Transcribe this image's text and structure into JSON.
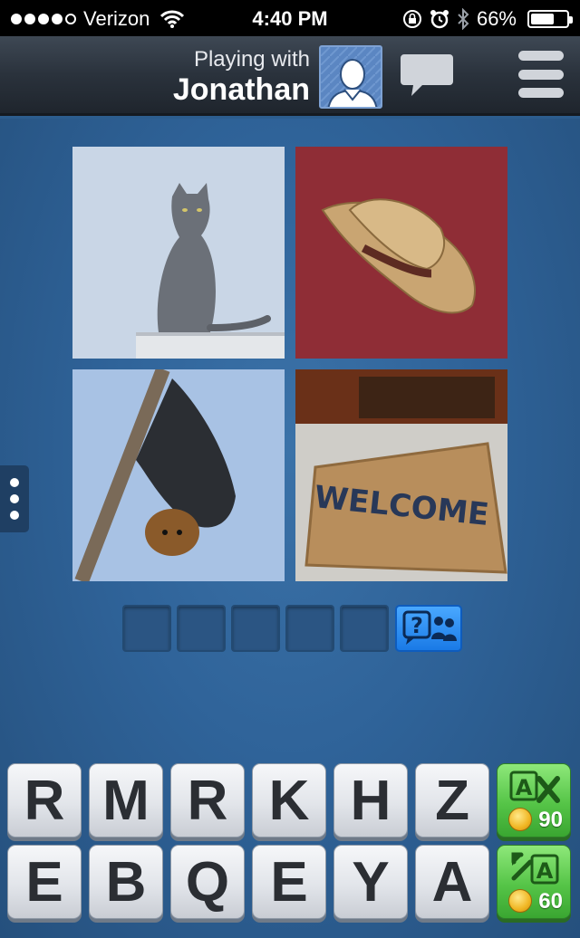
{
  "status_bar": {
    "carrier": "Verizon",
    "time": "4:40 PM",
    "battery_percent_text": "66%",
    "battery_level": 0.66
  },
  "header": {
    "playing_with_label": "Playing with",
    "opponent_name": "Jonathan",
    "avatar_icon": "person-avatar-icon",
    "chat_icon": "speech-bubble-icon",
    "menu_icon": "hamburger-menu-icon"
  },
  "puzzle": {
    "pictures": [
      {
        "subject": "cat"
      },
      {
        "subject": "hat"
      },
      {
        "subject": "bat"
      },
      {
        "subject": "mat"
      }
    ],
    "doormat_text": "WELCOME",
    "answer_slots": 5,
    "hint_icon": "question-and-people-icon"
  },
  "keyboard": {
    "row1": [
      "R",
      "M",
      "R",
      "K",
      "H",
      "Z"
    ],
    "row2": [
      "E",
      "B",
      "Q",
      "E",
      "Y",
      "A"
    ],
    "powerups": [
      {
        "name": "remove-letters",
        "icon": "letter-remove-icon",
        "cost": "90"
      },
      {
        "name": "reveal-letter",
        "icon": "letter-reveal-icon",
        "cost": "60"
      }
    ]
  },
  "colors": {
    "board_blue": "#2f6399",
    "hint_blue": "#1a7ae6",
    "powerup_green": "#55c447"
  }
}
